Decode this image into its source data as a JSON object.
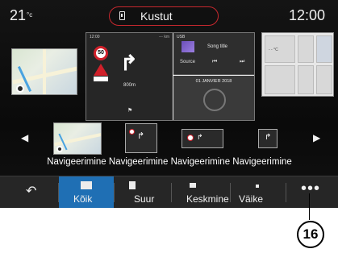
{
  "status": {
    "temperature": "21",
    "temp_unit": "°c",
    "time": "12:00",
    "pill_text": "Kustut"
  },
  "preview": {
    "nav_time": "12:00",
    "nav_km": "--- km",
    "speed_limit": "50",
    "distance": "800m",
    "usb_label": "USB",
    "song_title": "Song title",
    "source_label": "Source",
    "prev_symbol": "⏮",
    "next_symbol": "⏭",
    "date": "01 JANVIER 2018",
    "temp_small": "- - °C"
  },
  "carousel": {
    "left_arrow": "◀",
    "right_arrow": "▶"
  },
  "nav_label_text": "Navigeerimine Navigeerimine Navigeerimine Navigeerimine",
  "tabs": {
    "back_icon": "↶",
    "all": "Kõik",
    "large": "Suur",
    "medium": "Keskmine",
    "small": "Väike",
    "more": "•••"
  },
  "callout_number": "16",
  "colors": {
    "active_tab": "#1f6fb4",
    "pill_border": "#c8282e"
  }
}
